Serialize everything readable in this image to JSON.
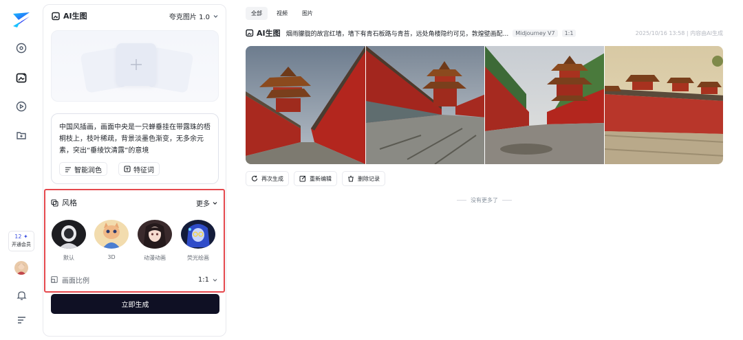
{
  "rail": {
    "logo": "app-logo",
    "icons": [
      "compass-icon",
      "image-gen-icon",
      "play-icon",
      "folder-icon"
    ],
    "member": {
      "count": "12 ✦",
      "label": "开通会员"
    },
    "bottom_icons": [
      "avatar",
      "bell-icon",
      "menu-icon"
    ]
  },
  "panel": {
    "title": "AI生图",
    "model": "夸克图片 1.0",
    "prompt_text": "中国风插画，画面中央是一只蝉垂挂在带露珠的梧桐枝上，枝叶稀疏，背景淡墨色渐变，无多余元素，突出“垂绫饮清露”的意境",
    "chips": {
      "polish": "智能润色",
      "keywords": "特征词"
    },
    "style_section": {
      "title": "风格",
      "more": "更多",
      "styles": [
        {
          "label": "默认",
          "icon": "astronaut-avatar"
        },
        {
          "label": "3D",
          "icon": "cat-3d-avatar"
        },
        {
          "label": "动漫动画",
          "icon": "anime-girl-avatar"
        },
        {
          "label": "荧光绘画",
          "icon": "neon-girl-avatar"
        }
      ]
    },
    "ratio": {
      "label": "画面比例",
      "value": "1:1"
    },
    "generate_label": "立即生成"
  },
  "main": {
    "tabs": [
      {
        "label": "全部",
        "active": true
      },
      {
        "label": "视频",
        "active": false
      },
      {
        "label": "图片",
        "active": false
      }
    ],
    "record": {
      "kind": "AI生图",
      "prompt": "烟雨朦胧的故宫红墙，墙下有青石板路与青苔，远处角楼隐约可见，敦煌壁画配...",
      "model_tag": "Midjourney V7",
      "ratio_tag": "1:1",
      "time": "2025/10/16 13:58 | 内容由AI生成"
    },
    "images": [
      "forbidden-city-corridor-left",
      "red-wall-stone-path",
      "corner-tower-path",
      "red-wall-palace-row"
    ],
    "actions": {
      "regenerate": "再次生成",
      "reedit": "重新编辑",
      "delete": "删除记录"
    },
    "no_more": "没有更多了"
  },
  "colors": {
    "accent": "#3b4fe0",
    "button_dark": "#0f1024",
    "highlight": "#e5484d",
    "wall_red": "#b3261e"
  }
}
